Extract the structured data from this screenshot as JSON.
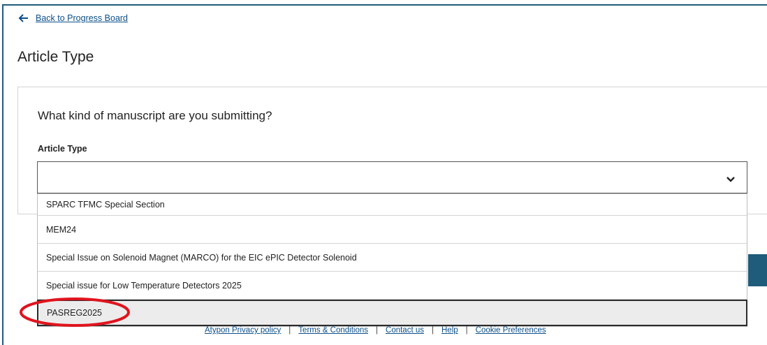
{
  "nav": {
    "back_label": "Back to Progress Board"
  },
  "page": {
    "title": "Article Type",
    "question": "What kind of manuscript are you submitting?",
    "field_label": "Article Type",
    "select_value": ""
  },
  "dropdown": {
    "options": [
      "SPARC TFMC Special Section",
      "MEM24",
      "Special Issue on Solenoid Magnet (MARCO) for the EIC ePIC Detector Solenoid",
      "Special issue for Low Temperature Detectors 2025",
      "PASREG2025"
    ],
    "highlighted": "PASREG2025"
  },
  "footer": {
    "links": [
      "Atypon Privacy policy",
      "Terms & Conditions",
      "Contact us",
      "Help",
      "Cookie Preferences"
    ],
    "separator": "|"
  },
  "colors": {
    "link": "#0b4f8a",
    "accent": "#1f5b7a",
    "annotation": "#e0141e"
  },
  "icons": {
    "back": "arrow-left-icon",
    "select": "chevron-down-icon"
  }
}
